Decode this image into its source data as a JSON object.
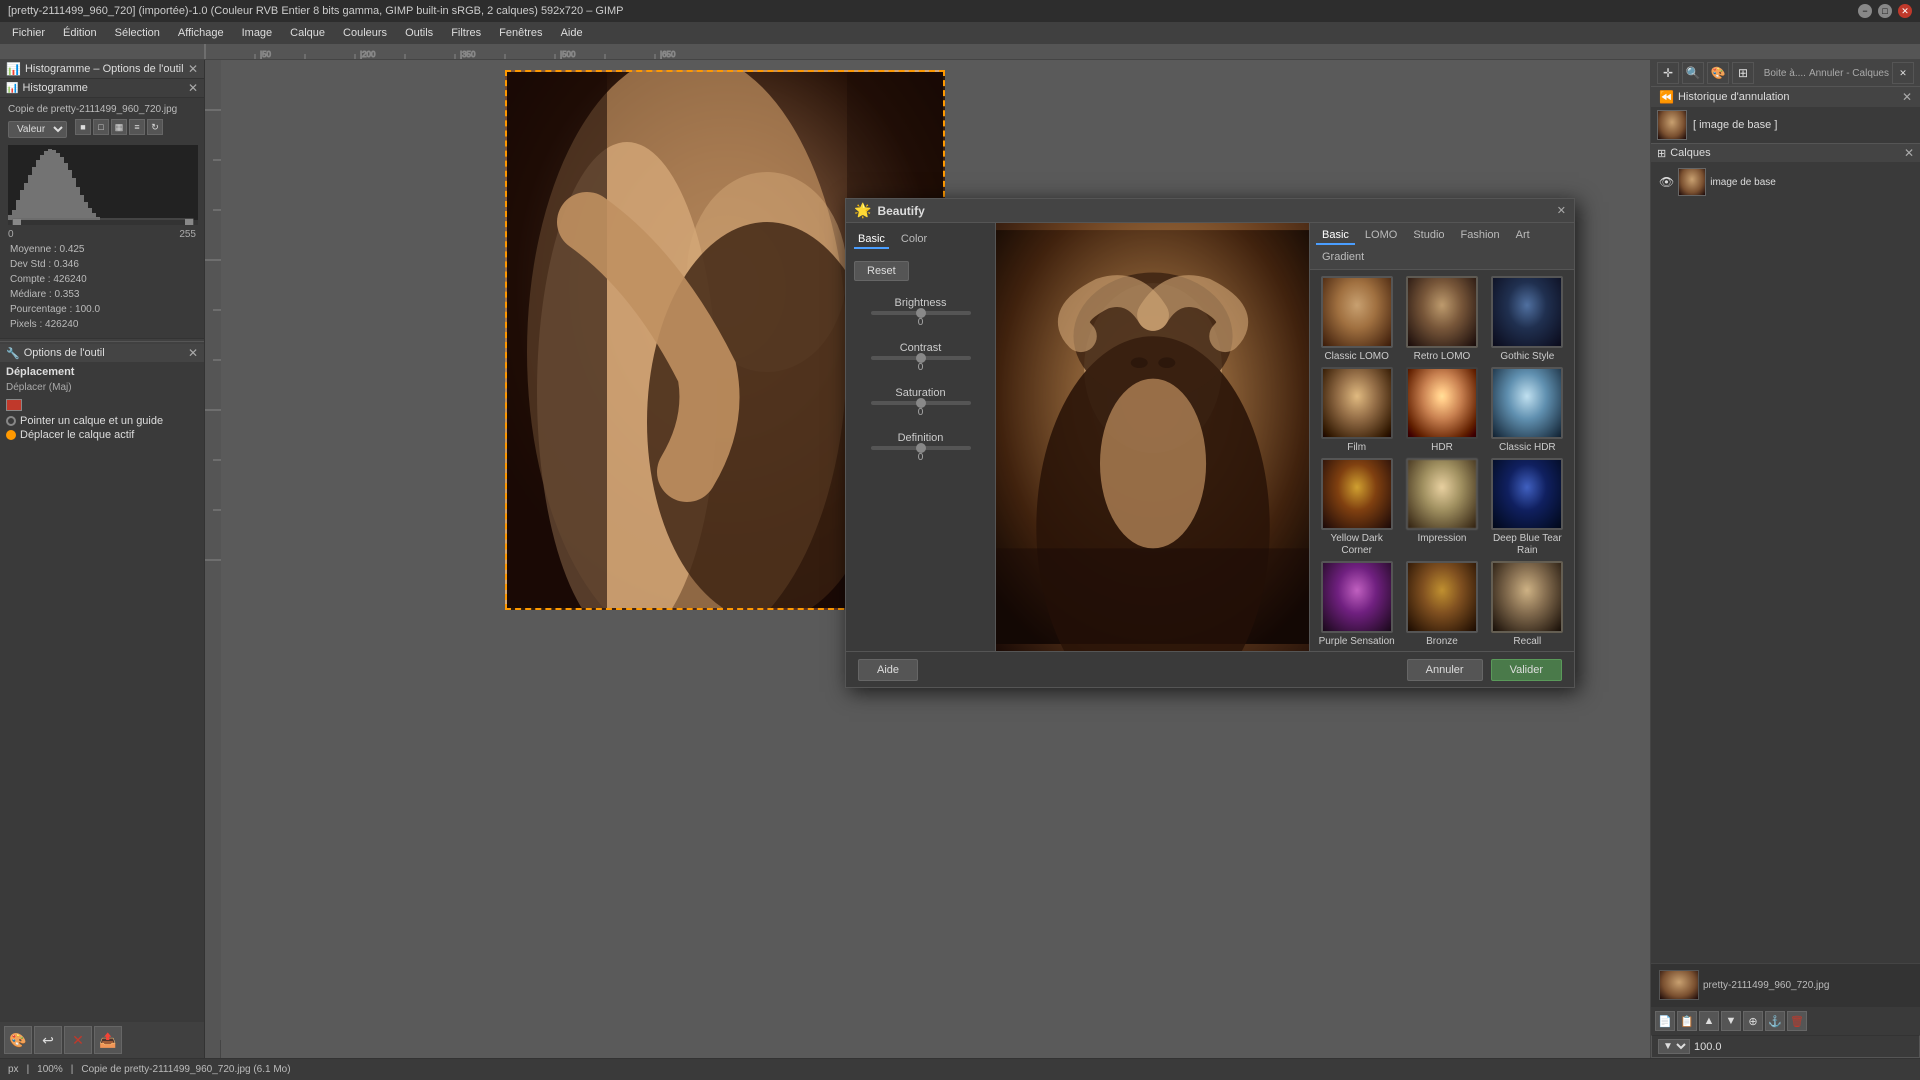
{
  "titlebar": {
    "title": "[pretty-2111499_960_720] (importée)-1.0 (Couleur RVB Entier 8 bits gamma, GIMP built-in sRGB, 2 calques) 592x720 – GIMP",
    "min": "−",
    "max": "□",
    "close": "✕"
  },
  "menubar": {
    "items": [
      "Fichier",
      "Édition",
      "Sélection",
      "Affichage",
      "Image",
      "Calque",
      "Couleurs",
      "Outils",
      "Filtres",
      "Fenêtres",
      "Aide"
    ]
  },
  "histogram": {
    "title": "Histogramme – Options de l'outil",
    "subtitle": "Histogramme",
    "filename": "Copie de pretty-2111499_960_720.jpg",
    "valeur_label": "Valeur",
    "range_min": "0",
    "range_max": "255",
    "stats": {
      "moyenne": "Moyenne : 0.425",
      "dev_std": "Dev Std : 0.346",
      "compte": "Compte : 426240",
      "mediane": "Médiare : 0.353",
      "pourcentage": "Pourcentage : 100.0"
    },
    "pixels": "Pixels : 426240",
    "compte": "Compte : 426240"
  },
  "tool_options": {
    "title": "Options de l'outil",
    "tool_name": "Déplacement",
    "keyboard_hint": "Déplacer (Maj)",
    "options": [
      "Pointer un calque et un guide",
      "Déplacer le calque actif"
    ]
  },
  "beautify": {
    "title": "Beautify",
    "tabs_left": [
      "Basic",
      "Color"
    ],
    "controls": {
      "brightness_label": "Brightness",
      "brightness_value": "0",
      "contrast_label": "Contrast",
      "contrast_value": "0",
      "saturation_label": "Saturation",
      "saturation_value": "0",
      "definition_label": "Definition",
      "definition_value": "0"
    },
    "reset_label": "Reset",
    "tabs_right": [
      "Basic",
      "LOMO",
      "Studio",
      "Fashion",
      "Art",
      "Gradient"
    ],
    "presets": [
      {
        "id": "classic-lomo",
        "label": "Classic LOMO",
        "style": "pt-classic-lomo"
      },
      {
        "id": "retro-lomo",
        "label": "Retro LOMO",
        "style": "pt-retro-lomo"
      },
      {
        "id": "gothic-style",
        "label": "Gothic Style",
        "style": "pt-gothic"
      },
      {
        "id": "film",
        "label": "Film",
        "style": "pt-film"
      },
      {
        "id": "hdr",
        "label": "HDR",
        "style": "pt-hdr"
      },
      {
        "id": "classic-hdr",
        "label": "Classic HDR",
        "style": "pt-classic-hdr"
      },
      {
        "id": "yellow-dark-corner",
        "label": "Yellow Dark Corner",
        "style": "pt-yellow-dark"
      },
      {
        "id": "impression",
        "label": "Impression",
        "style": "pt-impression"
      },
      {
        "id": "deep-blue-tear-rain",
        "label": "Deep Blue Tear Rain",
        "style": "pt-deep-blue"
      },
      {
        "id": "purple-sensation",
        "label": "Purple Sensation",
        "style": "pt-purple"
      },
      {
        "id": "bronze",
        "label": "Bronze",
        "style": "pt-bronze"
      },
      {
        "id": "recall",
        "label": "Recall",
        "style": "pt-recall"
      }
    ],
    "footer": {
      "help": "Aide",
      "cancel": "Annuler",
      "validate": "Valider"
    }
  },
  "undo": {
    "title": "Historique d'annulation",
    "item": "[ image de base ]"
  },
  "statusbar": {
    "unit": "px",
    "zoom": "100%",
    "filename": "Copie de pretty-2111499_960_720.jpg (6.1 Mo)"
  },
  "layers": {
    "title": "pretty-2111499_960_720.jpg"
  },
  "nav": {
    "dropdown_arrow": "▼",
    "measure_value": "100.0"
  }
}
